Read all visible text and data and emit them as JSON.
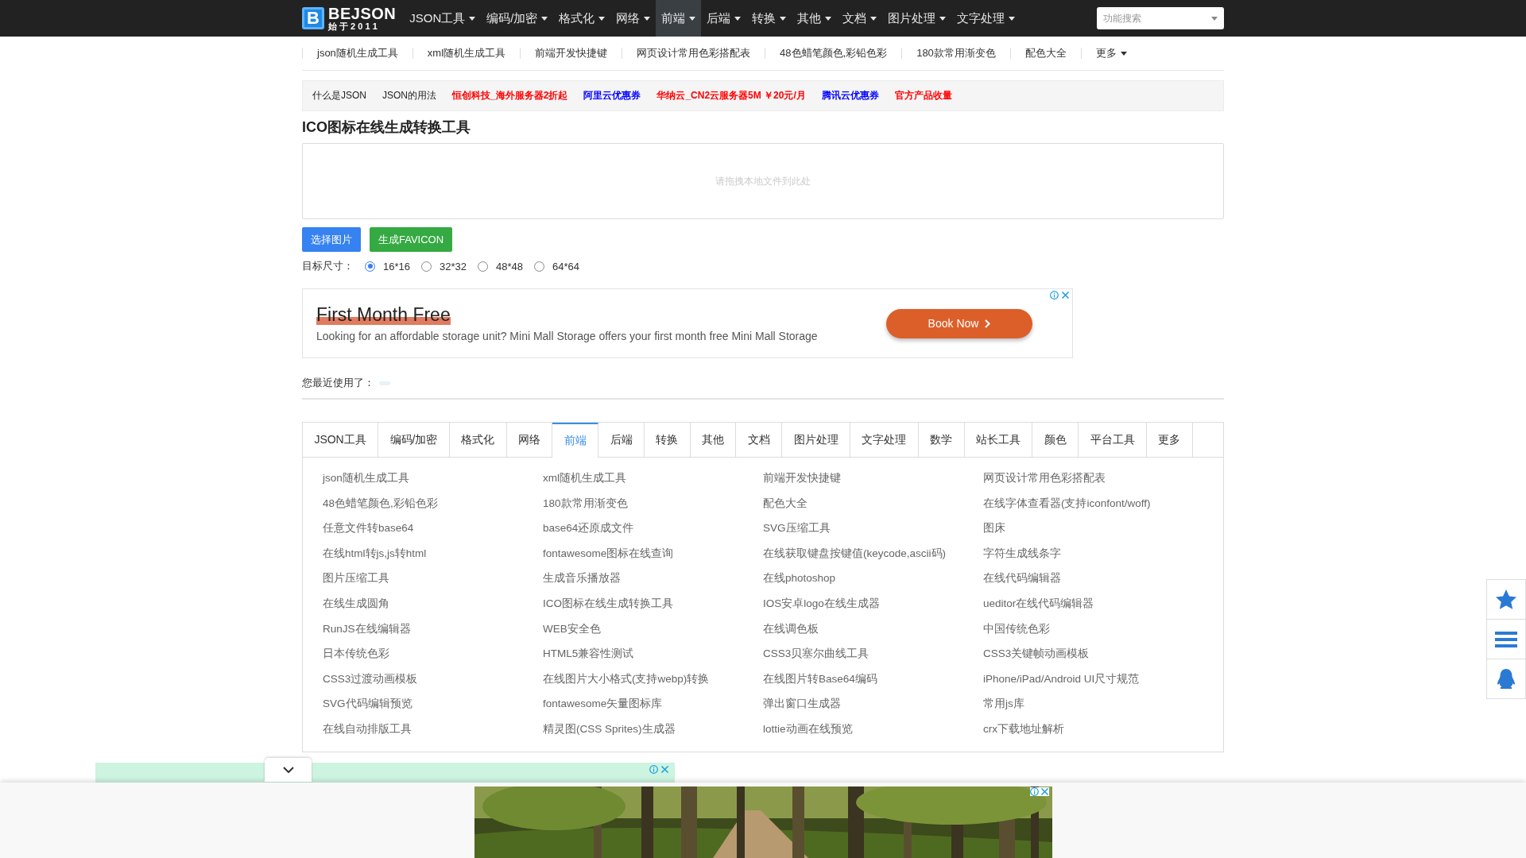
{
  "top_nav": {
    "logo": {
      "mark": "B",
      "name": "BEJSON",
      "tagline": "始 于 2 0 1 1"
    },
    "menu": [
      {
        "label": "JSON工具",
        "selected": false
      },
      {
        "label": "编码/加密",
        "selected": false
      },
      {
        "label": "格式化",
        "selected": false
      },
      {
        "label": "网络",
        "selected": false
      },
      {
        "label": "前端",
        "selected": true
      },
      {
        "label": "后端",
        "selected": false
      },
      {
        "label": "转换",
        "selected": false
      },
      {
        "label": "其他",
        "selected": false
      },
      {
        "label": "文档",
        "selected": false
      },
      {
        "label": "图片处理",
        "selected": false
      },
      {
        "label": "文字处理",
        "selected": false
      }
    ],
    "search": {
      "placeholder": "功能搜索"
    }
  },
  "sub_nav": {
    "items": [
      "json随机生成工具",
      "xml随机生成工具",
      "前端开发快捷键",
      "网页设计常用色彩搭配表",
      "48色蜡笔颜色,彩铅色彩",
      "180款常用渐变色",
      "配色大全"
    ],
    "more": "更多"
  },
  "link_bar": [
    {
      "label": "什么是JSON",
      "color": "#222222",
      "bold": false
    },
    {
      "label": "JSON的用法",
      "color": "#222222",
      "bold": false
    },
    {
      "label": "恒创科技_海外服务器2折起",
      "color": "#ff0000",
      "bold": true
    },
    {
      "label": "阿里云优惠券",
      "color": "#0000ff",
      "bold": true
    },
    {
      "label": "华纳云_CN2云服务器5M ￥20元/月",
      "color": "#ff0000",
      "bold": true
    },
    {
      "label": "腾讯云优惠券",
      "color": "#0000ff",
      "bold": true
    },
    {
      "label": "官方产品收量",
      "color": "#ff0000",
      "bold": true
    }
  ],
  "tool": {
    "title": "ICO图标在线生成转换工具",
    "drop_zone": {
      "placeholder": "请拖拽本地文件到此处"
    },
    "buttons": [
      {
        "label": "选择图片",
        "kind": "primary"
      },
      {
        "label": "生成FAVICON",
        "kind": "success"
      }
    ],
    "size_label": "目标尺寸：",
    "sizes": [
      {
        "label": "16*16",
        "selected": true
      },
      {
        "label": "32*32",
        "selected": false
      },
      {
        "label": "48*48",
        "selected": false
      },
      {
        "label": "64*64",
        "selected": false
      }
    ]
  },
  "ad": {
    "headline": "First Month Free",
    "text": "Looking for an affordable storage unit? Mini Mall Storage offers your first month free Mini Mall Storage",
    "button": "Book Now"
  },
  "recent": {
    "label": "您最近使用了："
  },
  "tabs": [
    {
      "label": "JSON工具",
      "selected": false
    },
    {
      "label": "编码/加密",
      "selected": false
    },
    {
      "label": "格式化",
      "selected": false
    },
    {
      "label": "网络",
      "selected": false
    },
    {
      "label": "前端",
      "selected": true
    },
    {
      "label": "后端",
      "selected": false
    },
    {
      "label": "转换",
      "selected": false
    },
    {
      "label": "其他",
      "selected": false
    },
    {
      "label": "文档",
      "selected": false
    },
    {
      "label": "图片处理",
      "selected": false
    },
    {
      "label": "文字处理",
      "selected": false
    },
    {
      "label": "数学",
      "selected": false
    },
    {
      "label": "站长工具",
      "selected": false
    },
    {
      "label": "颜色",
      "selected": false
    },
    {
      "label": "平台工具",
      "selected": false
    },
    {
      "label": "更多",
      "selected": false
    }
  ],
  "tool_links": [
    "json随机生成工具",
    "xml随机生成工具",
    "前端开发快捷键",
    "网页设计常用色彩搭配表",
    "48色蜡笔颜色,彩铅色彩",
    "180款常用渐变色",
    "配色大全",
    "在线字体查看器(支持iconfont/woff)",
    "任意文件转base64",
    "base64还原成文件",
    "SVG压缩工具",
    "图床",
    "在线html转js,js转html",
    "fontawesome图标在线查询",
    "在线获取键盘按键值(keycode,ascii码)",
    "字符生成线条字",
    "图片压缩工具",
    "生成音乐播放器",
    "在线photoshop",
    "在线代码编辑器",
    "在线生成圆角",
    "ICO图标在线生成转换工具",
    "IOS安卓logo在线生成器",
    "ueditor在线代码编辑器",
    "RunJS在线编辑器",
    "WEB安全色",
    "在线调色板",
    "中国传统色彩",
    "日本传统色彩",
    "HTML5兼容性测试",
    "CSS3贝塞尔曲线工具",
    "CSS3关键帧动画模板",
    "CSS3过渡动画模板",
    "在线图片大小格式(支持webp)转换",
    "在线图片转Base64编码",
    "iPhone/iPad/Android UI尺寸规范",
    "SVG代码编辑预览",
    "fontawesome矢量图标库",
    "弹出窗口生成器",
    "常用js库",
    "在线自动排版工具",
    "精灵图(CSS Sprites)生成器",
    "lottie动画在线预览",
    "crx下载地址解析"
  ]
}
